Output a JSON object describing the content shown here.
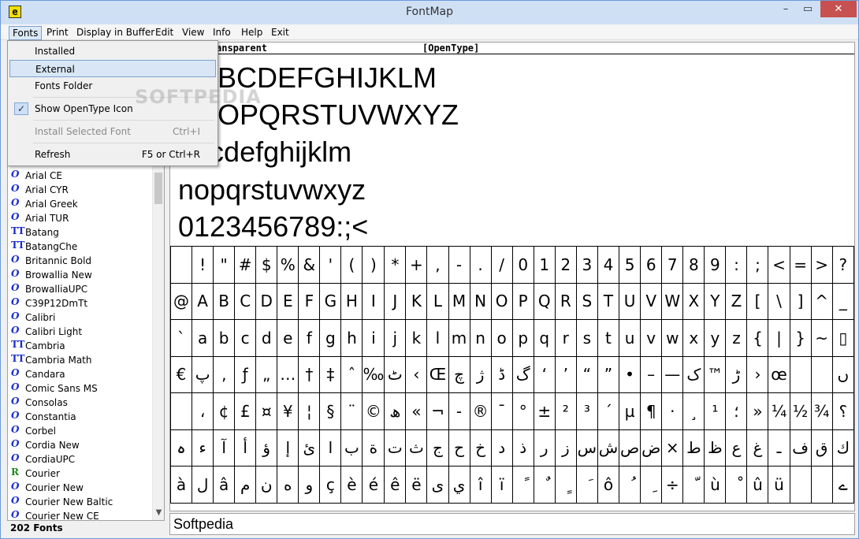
{
  "window": {
    "title": "FontMap",
    "app_icon": "e"
  },
  "window_buttons": {
    "minimize": "–",
    "maximize": "▭",
    "close": "✕"
  },
  "menu": [
    "Fonts",
    "Print",
    "Display in Buffer",
    "Edit",
    "View",
    "Info",
    "Help",
    "Exit"
  ],
  "dropdown": {
    "installed": "Installed",
    "external": "External",
    "fonts_folder": "Fonts Folder",
    "show_opentype": "Show OpenType Icon",
    "show_opentype_check": "✓",
    "install_selected": "Install Selected Font",
    "install_shortcut": "Ctrl+I",
    "refresh": "Refresh",
    "refresh_shortcut": "F5 or Ctrl+R"
  },
  "font_list": [
    {
      "name": "Arial CE",
      "icon": "O"
    },
    {
      "name": "Arial CYR",
      "icon": "O"
    },
    {
      "name": "Arial Greek",
      "icon": "O"
    },
    {
      "name": "Arial TUR",
      "icon": "O"
    },
    {
      "name": "Batang",
      "icon": "TT"
    },
    {
      "name": "BatangChe",
      "icon": "TT"
    },
    {
      "name": "Britannic Bold",
      "icon": "O"
    },
    {
      "name": "Browallia New",
      "icon": "O"
    },
    {
      "name": "BrowalliaUPC",
      "icon": "O"
    },
    {
      "name": "C39P12DmTt",
      "icon": "O"
    },
    {
      "name": "Calibri",
      "icon": "O"
    },
    {
      "name": "Calibri Light",
      "icon": "O"
    },
    {
      "name": "Cambria",
      "icon": "TT"
    },
    {
      "name": "Cambria Math",
      "icon": "TT"
    },
    {
      "name": "Candara",
      "icon": "O"
    },
    {
      "name": "Comic Sans MS",
      "icon": "O"
    },
    {
      "name": "Consolas",
      "icon": "O"
    },
    {
      "name": "Constantia",
      "icon": "O"
    },
    {
      "name": "Corbel",
      "icon": "O"
    },
    {
      "name": "Cordia New",
      "icon": "O"
    },
    {
      "name": "CordiaUPC",
      "icon": "O"
    },
    {
      "name": "Courier",
      "icon": "R"
    },
    {
      "name": "Courier New",
      "icon": "O"
    },
    {
      "name": "Courier New Baltic",
      "icon": "O"
    },
    {
      "name": "Courier New CE",
      "icon": "O"
    }
  ],
  "status": {
    "font_count": "202 Fonts"
  },
  "info": {
    "left": "ansparent",
    "right": "[OpenType]"
  },
  "samples": [
    "BCDEFGHIJKLM",
    "OPQRSTUVWXYZ",
    "abcdefghijklm",
    "nopqrstuvwxyz",
    "0123456789:;<"
  ],
  "char_rows": [
    [
      " ",
      "!",
      "\"",
      "#",
      "$",
      "%",
      "&",
      "'",
      "(",
      ")",
      "*",
      "+",
      ",",
      "-",
      ".",
      "/",
      "0",
      "1",
      "2",
      "3",
      "4",
      "5",
      "6",
      "7",
      "8",
      "9",
      ":",
      ";",
      "<",
      "=",
      ">",
      "?"
    ],
    [
      "@",
      "A",
      "B",
      "C",
      "D",
      "E",
      "F",
      "G",
      "H",
      "I",
      "J",
      "K",
      "L",
      "M",
      "N",
      "O",
      "P",
      "Q",
      "R",
      "S",
      "T",
      "U",
      "V",
      "W",
      "X",
      "Y",
      "Z",
      "[",
      "\\",
      "]",
      "^",
      "_"
    ],
    [
      "`",
      "a",
      "b",
      "c",
      "d",
      "e",
      "f",
      "g",
      "h",
      "i",
      "j",
      "k",
      "l",
      "m",
      "n",
      "o",
      "p",
      "q",
      "r",
      "s",
      "t",
      "u",
      "v",
      "w",
      "x",
      "y",
      "z",
      "{",
      "|",
      "}",
      "~",
      "▯"
    ],
    [
      "€",
      "پ",
      "‚",
      "ƒ",
      "„",
      "…",
      "†",
      "‡",
      "ˆ",
      "‰",
      "ٹ",
      "‹",
      "Œ",
      "چ",
      "ژ",
      "ڈ",
      "گ",
      "‘",
      "’",
      "“",
      "”",
      "•",
      "–",
      "—",
      "ک",
      "™",
      "ڑ",
      "›",
      "œ",
      "",
      "",
      "ں"
    ],
    [
      "",
      "،",
      "¢",
      "£",
      "¤",
      "¥",
      "¦",
      "§",
      "¨",
      "©",
      "ھ",
      "«",
      "¬",
      "-",
      "®",
      "¯",
      "°",
      "±",
      "²",
      "³",
      "´",
      "µ",
      "¶",
      "·",
      "¸",
      "¹",
      "؛",
      "»",
      "¼",
      "½",
      "¾",
      "؟"
    ],
    [
      "ہ",
      "ء",
      "آ",
      "أ",
      "ؤ",
      "إ",
      "ئ",
      "ا",
      "ب",
      "ة",
      "ت",
      "ث",
      "ج",
      "ح",
      "خ",
      "د",
      "ذ",
      "ر",
      "ز",
      "س",
      "ش",
      "ص",
      "ض",
      "×",
      "ط",
      "ظ",
      "ع",
      "غ",
      "ـ",
      "ف",
      "ق",
      "ك"
    ],
    [
      "à",
      "ل",
      "â",
      "م",
      "ن",
      "ه",
      "و",
      "ç",
      "è",
      "é",
      "ê",
      "ë",
      "ى",
      "ي",
      "î",
      "ï",
      "ً",
      "ٌ",
      "ٍ",
      "َ",
      "ô",
      "ُ",
      "ِ",
      "÷",
      "ّ",
      "ù",
      "ْ",
      "û",
      "ü",
      "",
      "",
      "ے"
    ]
  ],
  "input": {
    "value": "Softpedia"
  },
  "watermark": "SOFTPEDIA"
}
